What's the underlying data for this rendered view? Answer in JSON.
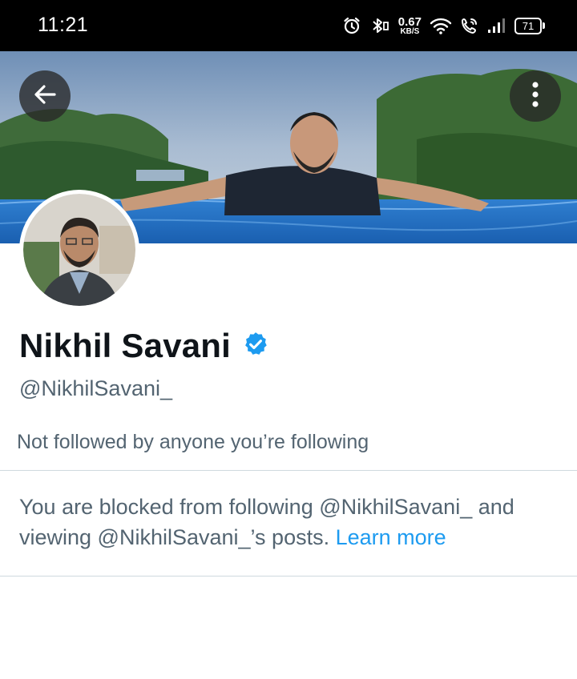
{
  "status_bar": {
    "time": "11:21",
    "net_speed_value": "0.67",
    "net_speed_unit": "KB/S",
    "battery_level": "71",
    "icons": [
      "alarm-icon",
      "bluetooth-icon",
      "wifi-icon",
      "wifi-calling-icon",
      "signal-icon",
      "battery-icon"
    ]
  },
  "header": {
    "back_icon": "arrow-left-icon",
    "more_icon": "more-vertical-icon"
  },
  "profile": {
    "name": "Nikhil Savani",
    "verified_icon": "verified-badge-icon",
    "handle": "@NikhilSavani_",
    "followed_by_text": "Not followed by anyone you’re following"
  },
  "blocked_notice": {
    "message": "You are blocked from following @NikhilSavani_ and viewing @NikhilSavani_’s posts.",
    "link_text": "Learn more"
  },
  "colors": {
    "primary_text": "#0f1419",
    "secondary_text": "#536471",
    "link": "#1d9bf0",
    "divider": "#cfd9de",
    "verified": "#1d9bf0"
  }
}
